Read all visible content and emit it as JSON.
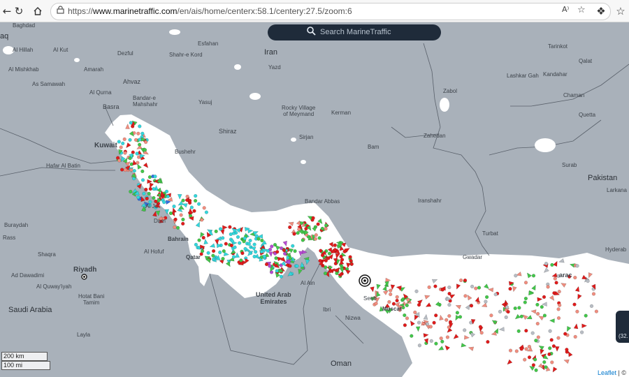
{
  "browser": {
    "url_prefix": "https://",
    "url_host": "www.marinetraffic.com",
    "url_path": "/en/ais/home/centerx:58.1/centery:27.5/zoom:6",
    "reader_icon": "A⁾"
  },
  "map": {
    "search_placeholder": "Search MarineTraffic",
    "scale_km": "200 km",
    "scale_mi": "100 mi",
    "attribution_leaflet": "Leaflet",
    "attribution_sep": " | ©",
    "side_widget_text": "(32.",
    "countries": {
      "iran": "Iran",
      "pakistan": "Pakistan",
      "saudi_arabia": "Saudi Arabia",
      "oman": "Oman",
      "iraq_partial": "aq",
      "uae": "United Arab\nEmirates"
    },
    "cities": [
      {
        "id": "baghdad",
        "text": "Baghdad"
      },
      {
        "id": "al-hillah",
        "text": "Al Hillah"
      },
      {
        "id": "al-kut",
        "text": "Al Kut"
      },
      {
        "id": "dezful",
        "text": "Dezful"
      },
      {
        "id": "shahr-e-kord",
        "text": "Shahr-e Kord"
      },
      {
        "id": "esfahan",
        "text": "Esfahan"
      },
      {
        "id": "yazd",
        "text": "Yazd"
      },
      {
        "id": "tarinkot",
        "text": "Tarinkot"
      },
      {
        "id": "qalat",
        "text": "Qalat"
      },
      {
        "id": "al-mishkhab",
        "text": "Al Mishkhab"
      },
      {
        "id": "amarah",
        "text": "Amarah"
      },
      {
        "id": "lashkar-gah",
        "text": "Lashkar Gah"
      },
      {
        "id": "kandahar",
        "text": "Kandahar"
      },
      {
        "id": "as-samawah",
        "text": "As Samawah"
      },
      {
        "id": "ahvaz",
        "text": "Ahvaz"
      },
      {
        "id": "al-qurna",
        "text": "Al Qurna"
      },
      {
        "id": "bandar-e-mahshahr",
        "text": "Bandar-e\nMahshahr"
      },
      {
        "id": "yasuj",
        "text": "Yasuj"
      },
      {
        "id": "zabol",
        "text": "Zabol"
      },
      {
        "id": "chaman",
        "text": "Chaman"
      },
      {
        "id": "basra",
        "text": "Basra"
      },
      {
        "id": "rocky-village",
        "text": "Rocky Village\nof Meymand"
      },
      {
        "id": "kerman",
        "text": "Kerman"
      },
      {
        "id": "quetta",
        "text": "Quetta"
      },
      {
        "id": "shiraz",
        "text": "Shiraz"
      },
      {
        "id": "sirjan",
        "text": "Sirjan"
      },
      {
        "id": "zahedan",
        "text": "Zahedan"
      },
      {
        "id": "kuwait",
        "text": "Kuwait"
      },
      {
        "id": "bushehr",
        "text": "Bushehr"
      },
      {
        "id": "bam",
        "text": "Bam"
      },
      {
        "id": "hafar-al-batin",
        "text": "Hafar Al Batin"
      },
      {
        "id": "surab",
        "text": "Surab"
      },
      {
        "id": "larkana",
        "text": "Larkana"
      },
      {
        "id": "al-jubail",
        "text": "Al Ju"
      },
      {
        "id": "bandar-abbas",
        "text": "Bandar Abbas"
      },
      {
        "id": "iranshahr",
        "text": "Iranshahr"
      },
      {
        "id": "buraydah",
        "text": "Buraydah"
      },
      {
        "id": "dammam",
        "text": "Dam"
      },
      {
        "id": "turbat",
        "text": "Turbat"
      },
      {
        "id": "rass",
        "text": "Rass"
      },
      {
        "id": "bahrain",
        "text": "Bahrain"
      },
      {
        "id": "hyderabad",
        "text": "Hyderab"
      },
      {
        "id": "al-hofuf",
        "text": "Al Hofuf"
      },
      {
        "id": "gwadar",
        "text": "Gwadar"
      },
      {
        "id": "shaqra",
        "text": "Shaqra"
      },
      {
        "id": "qatar",
        "text": "Qatar"
      },
      {
        "id": "karachi",
        "text": "arac"
      },
      {
        "id": "riyadh",
        "text": "Riyadh"
      },
      {
        "id": "ad-dawadimi",
        "text": "Ad Dawadimi"
      },
      {
        "id": "al-ain",
        "text": "Al Ain"
      },
      {
        "id": "al-quwayiyah",
        "text": "Al Quway'iyah"
      },
      {
        "id": "hotat-bani-tamim",
        "text": "Hotat Bani\nTamim"
      },
      {
        "id": "ibri",
        "text": "Ibri"
      },
      {
        "id": "seeb",
        "text": "Seeb"
      },
      {
        "id": "muscat",
        "text": "Muscat"
      },
      {
        "id": "nizwa",
        "text": "Nizwa"
      },
      {
        "id": "layla",
        "text": "Layla"
      }
    ],
    "colors": {
      "land": "#a9b1ba",
      "sea": "#ffffff",
      "tanker": "#e01b1b",
      "cargo": "#43c64a",
      "passenger": "#2f6fe0",
      "tug": "#33d6dc",
      "fishing": "#f08d7e",
      "pleasure": "#b64ad1",
      "unknown": "#b8bdc4"
    }
  }
}
